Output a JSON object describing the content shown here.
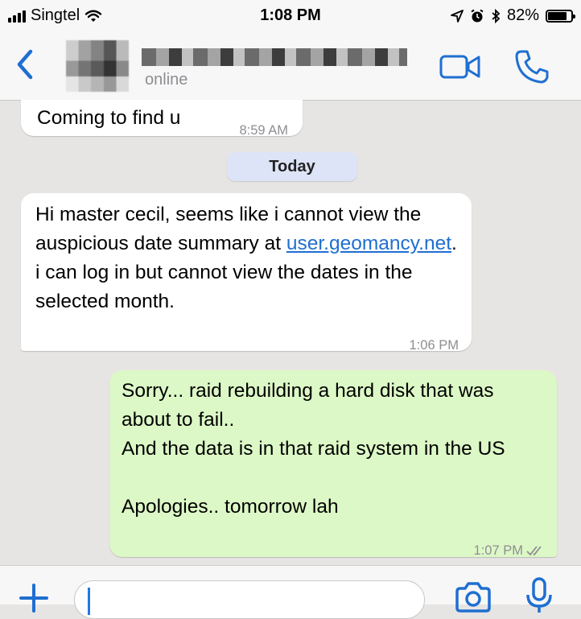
{
  "status_bar": {
    "carrier": "Singtel",
    "time": "1:08 PM",
    "battery": "82%",
    "battery_level": 0.82,
    "icons": [
      "signal-icon",
      "wifi-icon",
      "location-icon",
      "alarm-icon",
      "bluetooth-icon",
      "battery-icon"
    ]
  },
  "header": {
    "status": "online",
    "icons": [
      "back-chevron-icon",
      "video-call-icon",
      "phone-call-icon"
    ],
    "accent_color": "#1f6fd1"
  },
  "messages": [
    {
      "direction": "incoming",
      "text": "Coming to find u",
      "time": "8:59 AM"
    },
    {
      "direction": "incoming",
      "text_before_link": "Hi master cecil, seems like i cannot view the auspicious date summary at ",
      "link": "user.geomancy.net",
      "text_after_link": ". i can log in but cannot view the dates in the selected month.",
      "time": "1:06 PM"
    },
    {
      "direction": "outgoing",
      "text": "Sorry... raid rebuilding a hard disk that was about to fail..\nAnd the data is in that raid system in the US\n\nApologies.. tomorrow lah",
      "time": "1:07 PM",
      "read_receipt": "double-check-icon"
    }
  ],
  "date_separator": "Today",
  "input": {
    "value": "",
    "icons": [
      "plus-icon",
      "camera-icon",
      "microphone-icon"
    ]
  },
  "colors": {
    "chat_background": "#e7e5e3",
    "incoming_bubble": "#ffffff",
    "outgoing_bubble": "#dcf8c6",
    "date_chip": "#dde4f7",
    "link": "#1f6fd1"
  }
}
